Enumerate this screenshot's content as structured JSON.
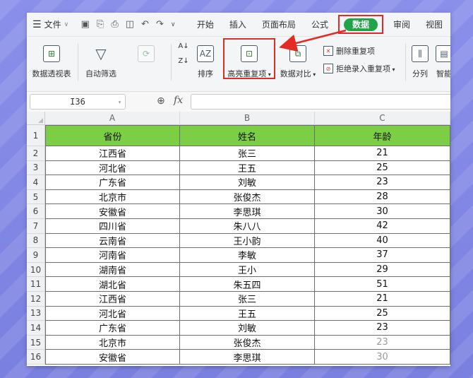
{
  "menubar": {
    "file_label": "文件",
    "tabs": [
      "开始",
      "插入",
      "页面布局",
      "公式"
    ],
    "active_tab": "数据",
    "tabs_after": [
      "审阅",
      "视图"
    ]
  },
  "ribbon": {
    "pivot_label": "数据透视表",
    "autofilter_label": "自动筛选",
    "reapply_label": "",
    "sort_label": "排序",
    "highlight_dup_label": "高亮重复项",
    "compare_label": "数据对比",
    "delete_dup_label": "删除重复项",
    "reject_dup_label": "拒绝录入重复项",
    "split_label": "分列",
    "smart_label": "智能"
  },
  "formula_bar": {
    "cell_ref": "I36",
    "fx_label": "fx",
    "formula_value": ""
  },
  "grid": {
    "columns": [
      "A",
      "B",
      "C"
    ],
    "header": {
      "row": "1",
      "cells": [
        "省份",
        "姓名",
        "年龄"
      ]
    },
    "rows": [
      {
        "row": "2",
        "cells": [
          "江西省",
          "张三",
          "21"
        ]
      },
      {
        "row": "3",
        "cells": [
          "河北省",
          "王五",
          "25"
        ]
      },
      {
        "row": "4",
        "cells": [
          "广东省",
          "刘敏",
          "23"
        ]
      },
      {
        "row": "5",
        "cells": [
          "北京市",
          "张俊杰",
          "28"
        ]
      },
      {
        "row": "6",
        "cells": [
          "安徽省",
          "李思琪",
          "30"
        ]
      },
      {
        "row": "7",
        "cells": [
          "四川省",
          "朱八八",
          "42"
        ]
      },
      {
        "row": "8",
        "cells": [
          "云南省",
          "王小韵",
          "40"
        ]
      },
      {
        "row": "9",
        "cells": [
          "河南省",
          "李敏",
          "37"
        ]
      },
      {
        "row": "10",
        "cells": [
          "湖南省",
          "王小",
          "29"
        ]
      },
      {
        "row": "11",
        "cells": [
          "湖北省",
          "朱五四",
          "51"
        ]
      },
      {
        "row": "12",
        "cells": [
          "江西省",
          "张三",
          "21"
        ]
      },
      {
        "row": "13",
        "cells": [
          "河北省",
          "王五",
          "25"
        ]
      },
      {
        "row": "14",
        "cells": [
          "广东省",
          "刘敏",
          "23"
        ]
      },
      {
        "row": "15",
        "cells": [
          "北京市",
          "张俊杰",
          "23"
        ]
      },
      {
        "row": "16",
        "cells": [
          "安徽省",
          "李思琪",
          "30"
        ]
      }
    ]
  },
  "colors": {
    "header_fill": "#7ccf45",
    "active_tab": "#21a34a",
    "annotation_red": "#e12b23",
    "background": "#7f86e6"
  }
}
